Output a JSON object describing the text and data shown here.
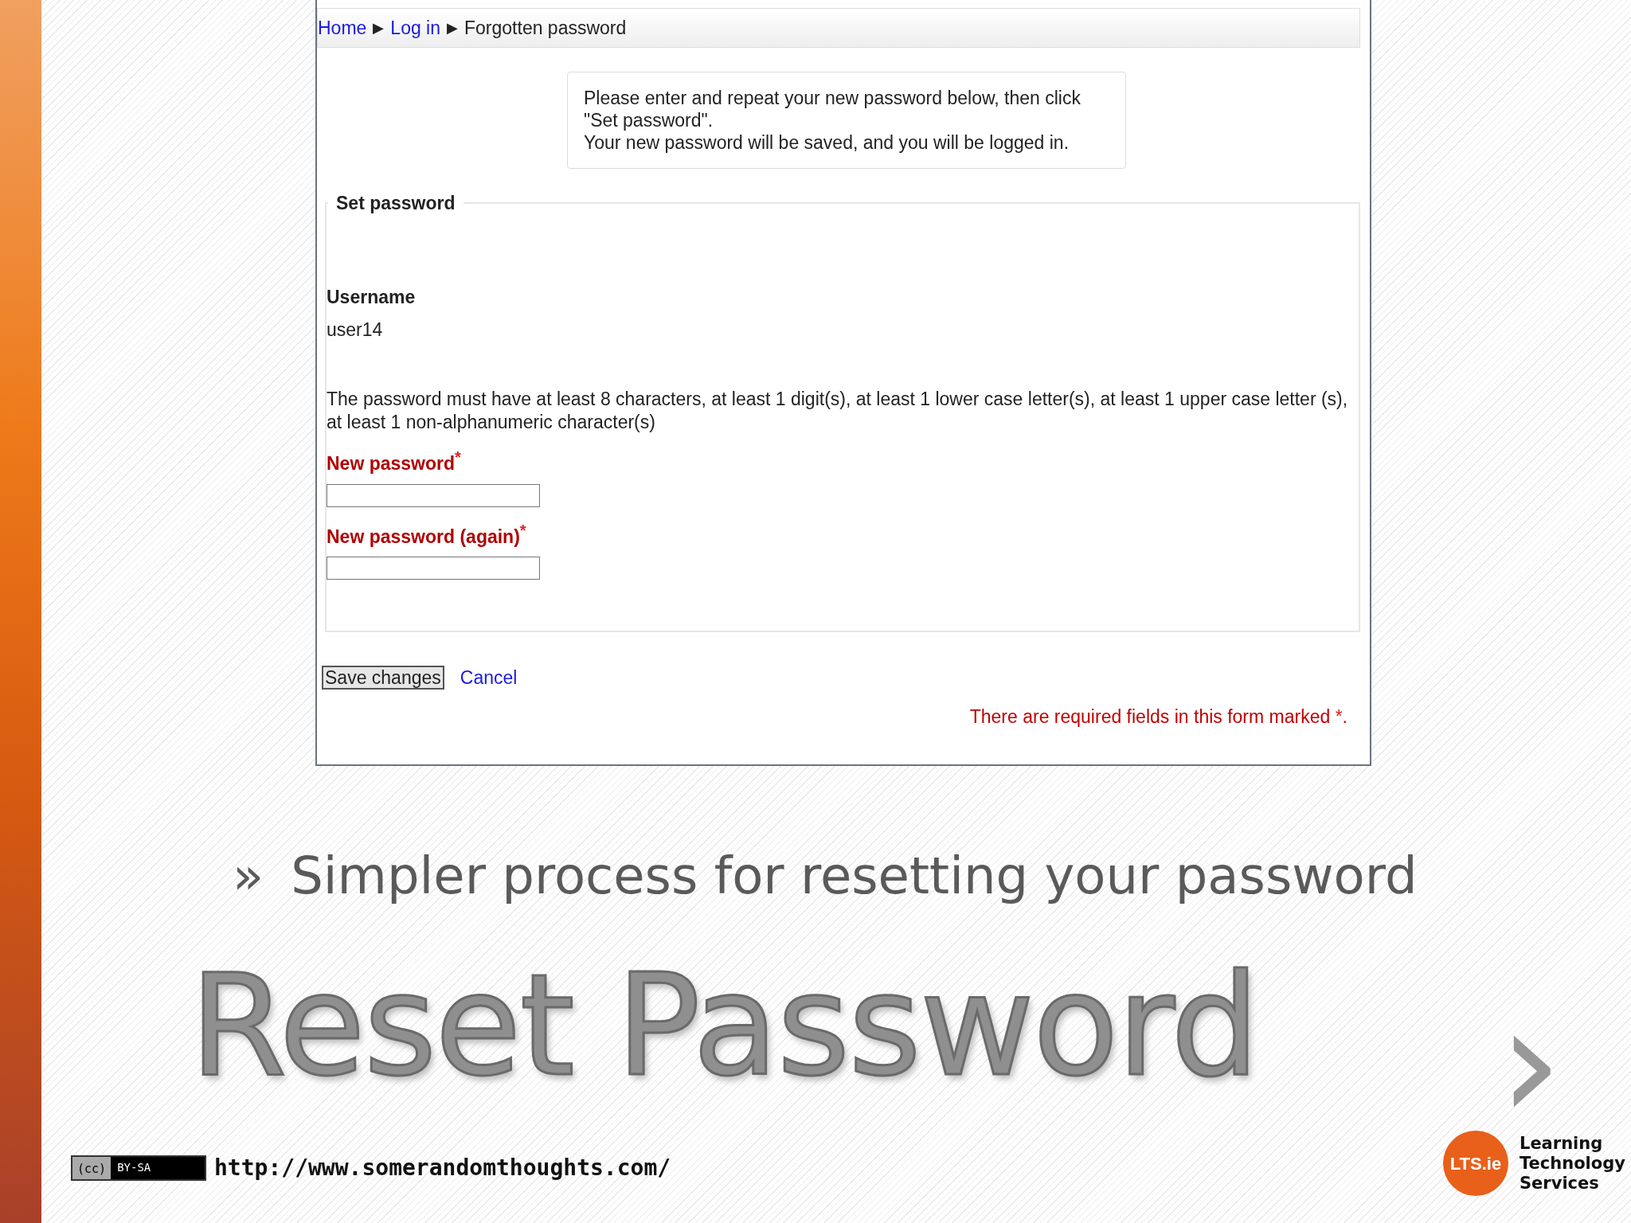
{
  "breadcrumb": [
    {
      "kind": "link",
      "label": "Home"
    },
    {
      "kind": "separator",
      "label": "▶"
    },
    {
      "kind": "link",
      "label": "Log in"
    },
    {
      "kind": "separator",
      "label": "▶"
    },
    {
      "kind": "current",
      "label": "Forgotten password"
    }
  ],
  "info_lines": [
    "Please enter and repeat your new password below, then click \"Set password\".",
    "Your new password will be saved, and you will be logged in."
  ],
  "fieldset": {
    "legend": "Set password",
    "username_label": "Username",
    "username_value": "user14",
    "rule": "The password must have at least 8 characters, at least 1 digit(s), at least 1 lower case letter(s), at least 1 upper case letter (s), at least 1 non-alphanumeric character(s)",
    "fields": [
      {
        "label": "New password",
        "mark": "*"
      },
      {
        "label": "New password (again)",
        "mark": "*"
      }
    ]
  },
  "buttons": {
    "save": "Save changes",
    "cancel": "Cancel"
  },
  "required_note": {
    "text": "There are required fields in this form marked",
    "mark": "*",
    "end": "."
  },
  "slide": {
    "bullet": "»",
    "subtitle": "Simpler process for resetting your password",
    "title": "Reset Password",
    "next": "›",
    "license": {
      "cc": "(cc)",
      "terms": "BY-SA"
    },
    "url": "http://www.somerandomthoughts.com/",
    "logo": {
      "badge": "LTS.ie",
      "words": [
        "Learning",
        "Technology",
        "Services"
      ]
    }
  }
}
